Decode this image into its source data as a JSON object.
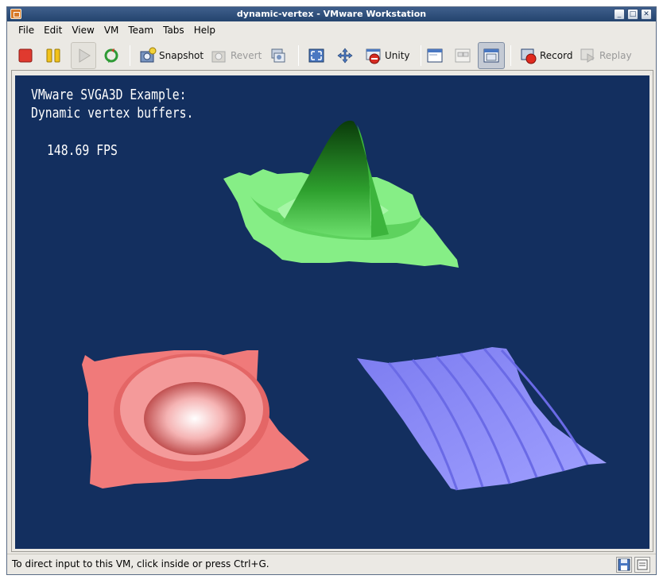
{
  "window": {
    "title": "dynamic-vertex - VMware Workstation"
  },
  "menu": [
    {
      "label": "File"
    },
    {
      "label": "Edit"
    },
    {
      "label": "View"
    },
    {
      "label": "VM"
    },
    {
      "label": "Team"
    },
    {
      "label": "Tabs"
    },
    {
      "label": "Help"
    }
  ],
  "toolbar": {
    "snapshot_label": "Snapshot",
    "revert_label": "Revert",
    "unity_label": "Unity",
    "record_label": "Record",
    "replay_label": "Replay"
  },
  "vm": {
    "line1": "VMware SVGA3D Example:",
    "line2": "Dynamic vertex buffers.",
    "fps": "148.69 FPS"
  },
  "status": {
    "text": "To direct input to this VM, click inside or press Ctrl+G."
  },
  "colors": {
    "vm_background": "#132f5f",
    "green_mesh": "#7cf07c",
    "red_mesh": "#f07878",
    "blue_mesh": "#8a8af5",
    "title_bar": "#2f4f7c"
  }
}
